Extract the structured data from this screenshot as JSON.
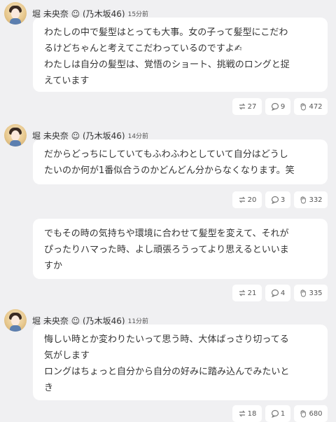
{
  "posts": [
    {
      "author": "堀 未央奈 ☺ (乃木坂46)",
      "time": "15分前",
      "lines": [
        "わたしの中で髪型はとっても大事。女の子って髪型にこだわ",
        "るけどちゃんと考えてこだわっているのですよ✍",
        "わたしは自分の髪型は、覚悟のショート、挑戦のロングと捉",
        "えています"
      ],
      "retweets": "27",
      "replies": "9",
      "likes": "472"
    },
    {
      "author": "堀 未央奈 ☺ (乃木坂46)",
      "time": "14分前",
      "lines": [
        "だからどっちにしていてもふわふわとしていて自分はどうし",
        "たいのか何が1番似合うのかどんどん分からなくなります。笑"
      ],
      "retweets": "20",
      "replies": "3",
      "likes": "332"
    },
    {
      "lines": [
        "でもその時の気持ちや環境に合わせて髪型を変えて、それが",
        "ぴったりハマった時、よし頑張ろうってより思えるといいま",
        "すか"
      ],
      "retweets": "21",
      "replies": "4",
      "likes": "335"
    },
    {
      "author": "堀 未央奈 ☺ (乃木坂46)",
      "time": "11分前",
      "lines": [
        "悔しい時とか変わりたいって思う時、大体ばっさり切ってる",
        "気がします",
        "ロングはちょっと自分から自分の好みに踏み込んでみたいと",
        "き"
      ],
      "retweets": "18",
      "replies": "1",
      "likes": "680"
    }
  ],
  "icons": {
    "avatar": "avatar-photo",
    "retweet": "retweet-icon",
    "reply": "reply-icon",
    "like": "like-icon"
  }
}
